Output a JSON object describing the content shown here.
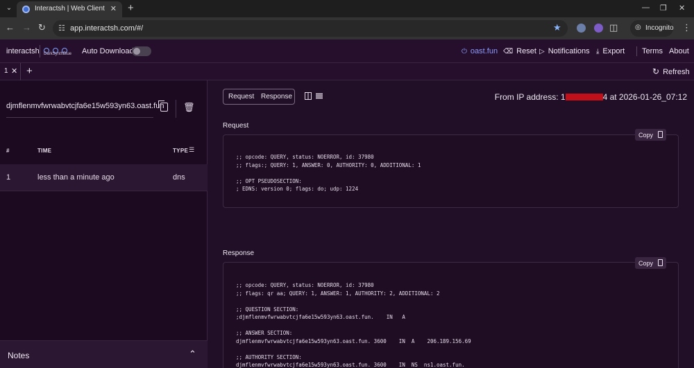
{
  "browser": {
    "tab_title": "Interactsh | Web Client",
    "url": "app.interactsh.com/#/",
    "incognito_label": "Incognito"
  },
  "header": {
    "brand": "interactsh",
    "theme_name": "DarkSynthBlue",
    "auto_download_label": "Auto Download",
    "auto_download_on": false,
    "server": "oast.fun",
    "reset": "Reset",
    "notifications": "Notifications",
    "export": "Export",
    "terms": "Terms",
    "about": "About"
  },
  "tabs": {
    "active_tab": "1",
    "refresh": "Refresh"
  },
  "left": {
    "domain": "djmflenmvfwrwabvtcjfa6e15w593yn63.oast.fun",
    "columns": {
      "num": "#",
      "time": "TIME",
      "type": "TYPE"
    },
    "rows": [
      {
        "num": "1",
        "time": "less than a minute ago",
        "type": "dns"
      }
    ],
    "notes": "Notes"
  },
  "right": {
    "view_request": "Request",
    "view_response": "Response",
    "from_ip_prefix": "From IP address: 1",
    "from_ip_suffix": "4 at 2026-01-26_07:12",
    "request_title": "Request",
    "response_title": "Response",
    "copy_label": "Copy",
    "request_lines": [
      ";; opcode: QUERY, status: NOERROR, id: 37980",
      ";; flags:; QUERY: 1, ANSWER: 0, AUTHORITY: 0, ADDITIONAL: 1",
      "",
      ";; OPT PSEUDOSECTION:",
      "; EDNS: version 0; flags: do; udp: 1224"
    ],
    "response_lines": [
      ";; opcode: QUERY, status: NOERROR, id: 37980",
      ";; flags: qr aa; QUERY: 1, ANSWER: 1, AUTHORITY: 2, ADDITIONAL: 2",
      "",
      ";; QUESTION SECTION:",
      ";djmflenmvfwrwabvtcjfa6e15w593yn63.oast.fun.    IN   A",
      "",
      ";; ANSWER SECTION:",
      "djmflenmvfwrwabvtcjfa6e15w593yn63.oast.fun. 3600    IN  A    206.189.156.69",
      "",
      ";; AUTHORITY SECTION:",
      "djmflenmvfwrwabvtcjfa6e15w593yn63.oast.fun. 3600    IN  NS  ns1.oast.fun."
    ]
  }
}
